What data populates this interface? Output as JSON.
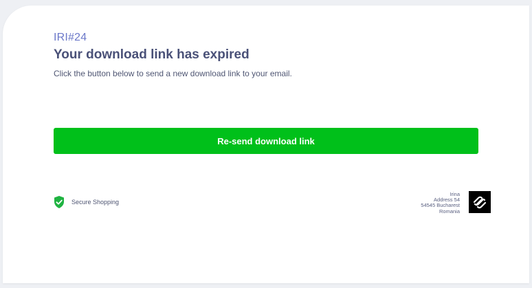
{
  "order": {
    "id": "IRI#24"
  },
  "message": {
    "title": "Your download link has expired",
    "subtitle": "Click the button below to send a new download link to your email."
  },
  "actions": {
    "resend_label": "Re-send download link",
    "button_color": "#00c01a"
  },
  "footer": {
    "secure_label": "Secure Shopping",
    "secure_icon": "shield-check-icon",
    "address": {
      "name": "Irina",
      "street": "Address 54",
      "city": "54545 Bucharest",
      "country": "Romania"
    },
    "logo_icon": "squarespace-logo-icon"
  },
  "colors": {
    "accent": "#6b78c9",
    "heading": "#4a5178",
    "success": "#00c01a"
  }
}
